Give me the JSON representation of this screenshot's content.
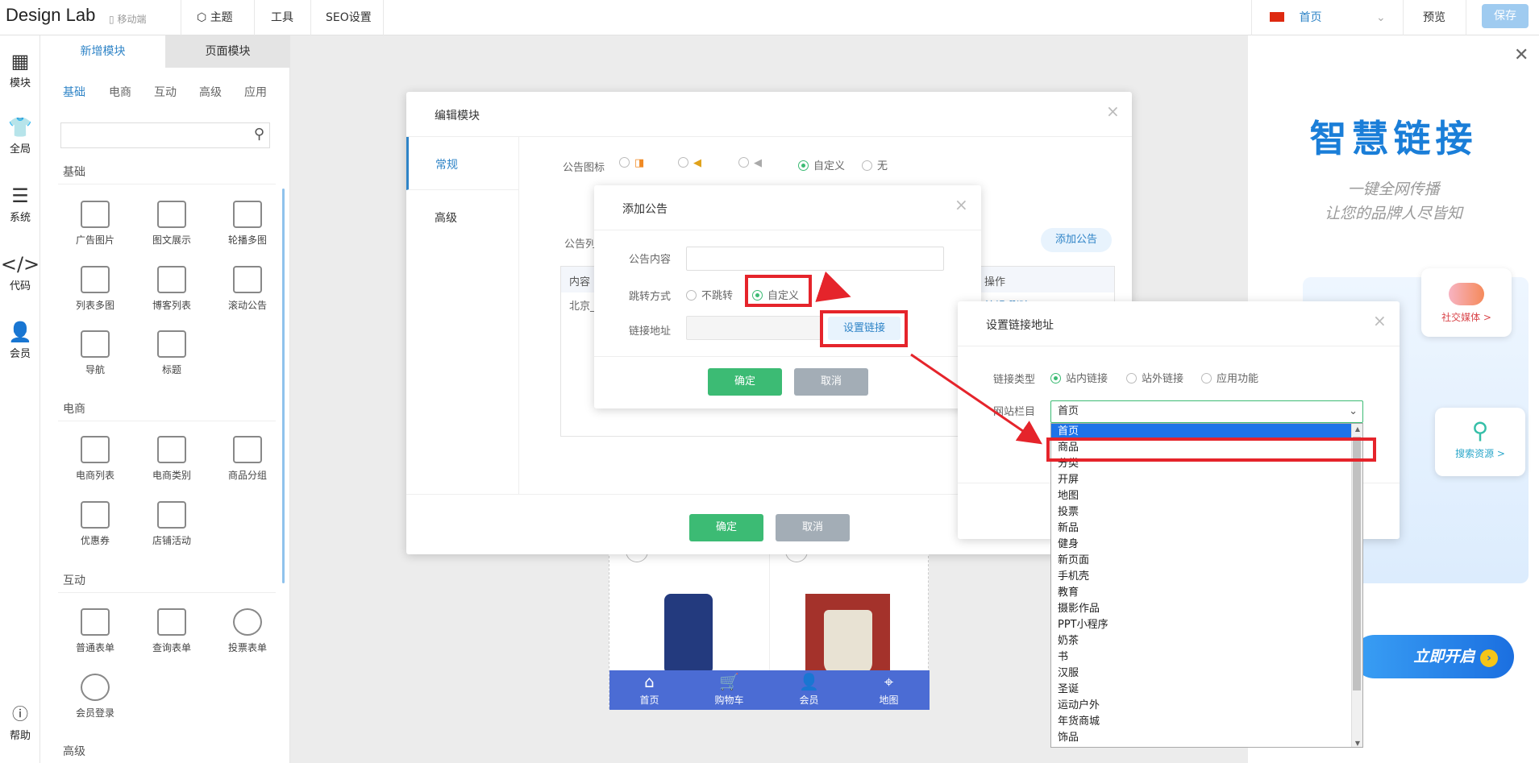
{
  "topbar": {
    "logo": "Design Lab",
    "mobile_label": "移动端",
    "nav": [
      "主题",
      "工具",
      "SEO设置"
    ],
    "page_select": "首页",
    "preview": "预览",
    "save": "保存"
  },
  "rail": {
    "items": [
      "模块",
      "全局",
      "系统",
      "代码",
      "会员"
    ],
    "help": "帮助"
  },
  "panel": {
    "tabs": [
      "新增模块",
      "页面模块"
    ],
    "subtabs": [
      "基础",
      "电商",
      "互动",
      "高级",
      "应用"
    ],
    "sections": [
      {
        "title": "基础",
        "modules": [
          "广告图片",
          "图文展示",
          "轮播多图",
          "列表多图",
          "博客列表",
          "滚动公告",
          "导航",
          "标题"
        ]
      },
      {
        "title": "电商",
        "modules": [
          "电商列表",
          "电商类别",
          "商品分组",
          "优惠券",
          "店铺活动"
        ]
      },
      {
        "title": "互动",
        "modules": [
          "普通表单",
          "查询表单",
          "投票表单",
          "会员登录"
        ]
      },
      {
        "title": "高级",
        "modules": []
      }
    ]
  },
  "phone": {
    "bottom_nav": [
      "首页",
      "购物车",
      "会员",
      "地图"
    ]
  },
  "promo": {
    "title": "智慧链接",
    "sub1": "一键全网传播",
    "sub2": "让您的品牌人尽皆知",
    "card1": "社交媒体 >",
    "card2": "搜索资源 >",
    "start": "立即开启"
  },
  "edit_module": {
    "title": "编辑模块",
    "tabs": [
      "常规",
      "高级"
    ],
    "icon_label": "公告图标",
    "icon_opt_custom": "自定义",
    "icon_opt_none": "无",
    "list_label": "公告列",
    "add_btn": "添加公告",
    "col_content": "内容",
    "col_op": "操作",
    "row_text": "北京_",
    "row_ops": "编辑 删除",
    "ok": "确定",
    "cancel": "取消"
  },
  "add_notice": {
    "title": "添加公告",
    "content_label": "公告内容",
    "jump_label": "跳转方式",
    "opt_nojump": "不跳转",
    "opt_custom": "自定义",
    "link_label": "链接地址",
    "set_link": "设置链接",
    "ok": "确定",
    "cancel": "取消"
  },
  "set_link": {
    "title": "设置链接地址",
    "type_label": "链接类型",
    "types": [
      "站内链接",
      "站外链接",
      "应用功能"
    ],
    "column_label": "网站栏目",
    "selected": "首页"
  },
  "dropdown": {
    "items": [
      "首页",
      "商品",
      "分类",
      "开屏",
      "地图",
      "投票",
      "新品",
      "健身",
      "新页面",
      "手机壳",
      "教育",
      "摄影作品",
      "PPT小程序",
      "奶茶",
      "书",
      "汉服",
      "圣诞",
      "运动户外",
      "年货商城",
      "饰品"
    ]
  },
  "colors": {
    "accent": "#2f84c7",
    "green": "#3cbb74",
    "red": "#e5242b",
    "nav_blue": "#4b6cd4"
  }
}
